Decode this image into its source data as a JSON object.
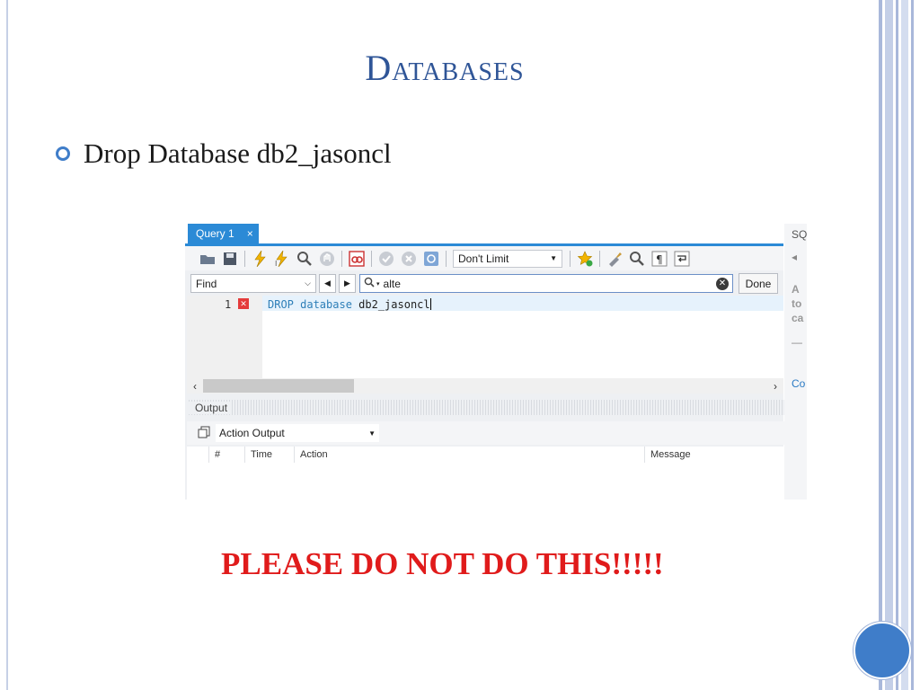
{
  "slide": {
    "title": "Databases",
    "bullet": "Drop Database db2_jasoncl",
    "warning": "PLEASE DO NOT DO THIS!!!!!"
  },
  "workbench": {
    "tab": {
      "label": "Query 1",
      "close": "×"
    },
    "toolbar": {
      "icons": [
        "open-folder-icon",
        "save-icon",
        "execute-icon",
        "execute-current-icon",
        "explain-icon",
        "stop-icon",
        "toggle-results-icon",
        "commit-icon",
        "rollback-icon",
        "autocommit-icon",
        "limit-select",
        "add-snippet-icon",
        "beautify-icon",
        "find-icon",
        "invisible-chars-icon",
        "wrap-icon"
      ],
      "limit_label": "Don't Limit"
    },
    "find": {
      "mode": "Find",
      "query": "alte",
      "done_label": "Done"
    },
    "editor": {
      "line_number": "1",
      "sql": {
        "statement": "DROP database db2_jasoncl"
      }
    },
    "output": {
      "header": "Output",
      "selector": "Action Output",
      "columns": [
        "#",
        "Time",
        "Action",
        "Message"
      ]
    },
    "side_panel": {
      "label_top": "SQ",
      "lines": [
        "A",
        "to",
        "ca",
        "—"
      ],
      "label_bottom": "Co"
    }
  },
  "colors": {
    "title": "#2f5597",
    "warning": "#e01b1b",
    "tab": "#2b8ad6",
    "sql_keyword": "#2e7fb8"
  }
}
